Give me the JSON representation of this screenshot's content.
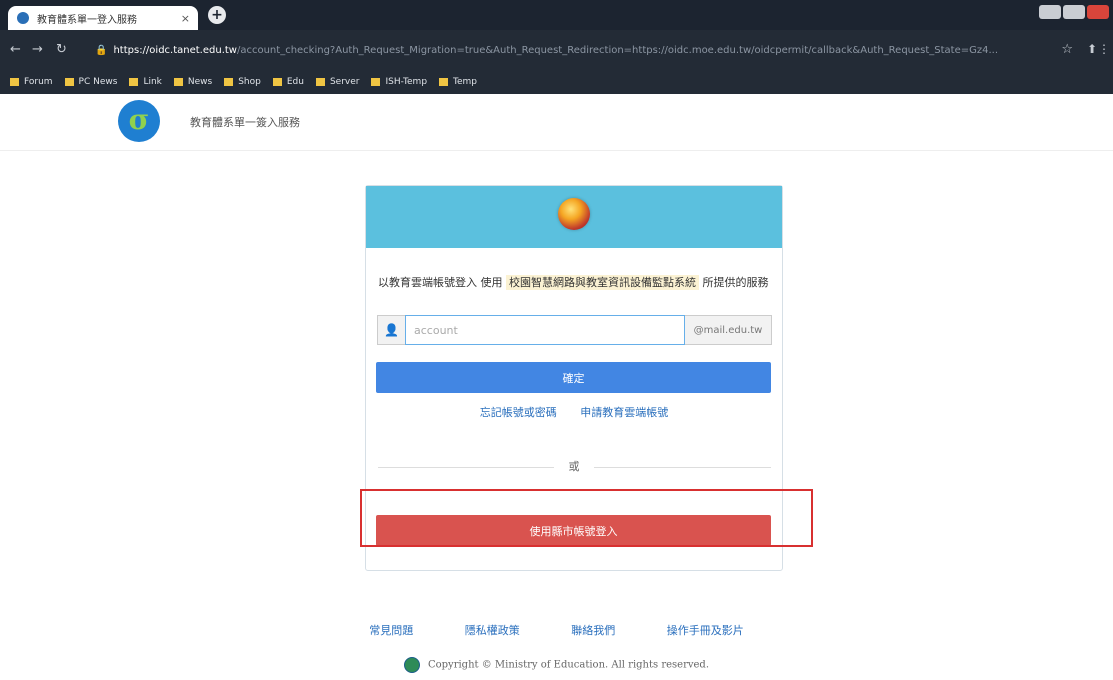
{
  "browser": {
    "tab_title": "教育體系單一登入服務",
    "tab_close": "×",
    "new_tab": "+",
    "url_host": "https://oidc.tanet.edu.tw",
    "url_path": "/account_checking?Auth_Request_Migration=true&Auth_Request_Redirection=https://oidc.moe.edu.tw/oidcpermit/callback&Auth_Request_State=Gz4...",
    "bookmarks": [
      "Forum",
      "PC News",
      "Link",
      "News",
      "Shop",
      "Edu",
      "Server",
      "ISH-Temp",
      "Temp"
    ]
  },
  "header": {
    "logo_text": "σ",
    "title": "教育體系單一簽入服務"
  },
  "login": {
    "desc_prefix": "以教育雲端帳號登入 使用",
    "desc_service": "校園智慧網路與教室資訊設備監點系統",
    "desc_suffix": "所提供的服務",
    "user_icon": "👤",
    "account_placeholder": "account",
    "email_suffix": "@mail.edu.tw",
    "confirm_button": "確定",
    "forgot_link": "忘記帳號或密碼",
    "apply_link": "申請教育雲端帳號",
    "or_text": "或",
    "city_login_button": "使用縣市帳號登入"
  },
  "footer": {
    "links": [
      "常見問題",
      "隱私權政策",
      "聯絡我們",
      "操作手冊及影片"
    ],
    "copyright": "Copyright © Ministry of Education. All rights reserved."
  },
  "colors": {
    "card_header": "#5bc0de",
    "confirm_blue": "#4286e3",
    "city_red": "#d9534f",
    "highlight": "#d83030"
  }
}
